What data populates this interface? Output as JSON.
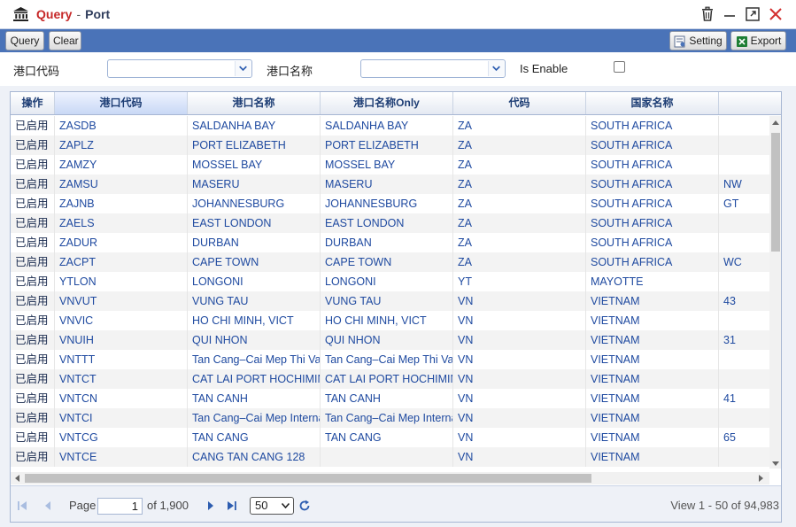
{
  "window": {
    "title": "Query",
    "separator": "-",
    "subtitle": "Port",
    "icons": [
      "bank-icon",
      "trash-icon",
      "minimize-icon",
      "maximize-icon",
      "close-icon"
    ]
  },
  "toolbar": {
    "query_label": "Query",
    "clear_label": "Clear",
    "setting_label": "Setting",
    "export_label": "Export"
  },
  "filters": {
    "port_code_label": "港口代码",
    "port_name_label": "港口名称",
    "is_enable_label": "Is Enable",
    "port_code_value": "",
    "port_name_value": ""
  },
  "grid": {
    "columns": [
      "操作",
      "港口代码",
      "港口名称",
      "港口名称Only",
      "代码",
      "国家名称",
      ""
    ],
    "rows": [
      [
        "已启用",
        "ZASDB",
        "SALDANHA BAY",
        "SALDANHA BAY",
        "ZA",
        "SOUTH AFRICA",
        ""
      ],
      [
        "已启用",
        "ZAPLZ",
        "PORT ELIZABETH",
        "PORT ELIZABETH",
        "ZA",
        "SOUTH AFRICA",
        ""
      ],
      [
        "已启用",
        "ZAMZY",
        "MOSSEL BAY",
        "MOSSEL BAY",
        "ZA",
        "SOUTH AFRICA",
        ""
      ],
      [
        "已启用",
        "ZAMSU",
        "MASERU",
        "MASERU",
        "ZA",
        "SOUTH AFRICA",
        "NW"
      ],
      [
        "已启用",
        "ZAJNB",
        "JOHANNESBURG",
        "JOHANNESBURG",
        "ZA",
        "SOUTH AFRICA",
        "GT"
      ],
      [
        "已启用",
        "ZAELS",
        "EAST LONDON",
        "EAST LONDON",
        "ZA",
        "SOUTH AFRICA",
        ""
      ],
      [
        "已启用",
        "ZADUR",
        "DURBAN",
        "DURBAN",
        "ZA",
        "SOUTH AFRICA",
        ""
      ],
      [
        "已启用",
        "ZACPT",
        "CAPE TOWN",
        "CAPE TOWN",
        "ZA",
        "SOUTH AFRICA",
        "WC"
      ],
      [
        "已启用",
        "YTLON",
        "LONGONI",
        "LONGONI",
        "YT",
        "MAYOTTE",
        ""
      ],
      [
        "已启用",
        "VNVUT",
        "VUNG TAU",
        "VUNG TAU",
        "VN",
        "VIETNAM",
        "43"
      ],
      [
        "已启用",
        "VNVIC",
        "HO CHI MINH, VICT",
        "HO CHI MINH, VICT",
        "VN",
        "VIETNAM",
        ""
      ],
      [
        "已启用",
        "VNUIH",
        "QUI NHON",
        "QUI NHON",
        "VN",
        "VIETNAM",
        "31"
      ],
      [
        "已启用",
        "VNTTT",
        "Tan Cang–Cai Mep Thi Vai",
        "Tan Cang–Cai Mep Thi Vai",
        "VN",
        "VIETNAM",
        ""
      ],
      [
        "已启用",
        "VNTCT",
        "CAT LAI PORT HOCHIMINH",
        "CAT LAI PORT HOCHIMINH",
        "VN",
        "VIETNAM",
        ""
      ],
      [
        "已启用",
        "VNTCN",
        "TAN CANH",
        "TAN CANH",
        "VN",
        "VIETNAM",
        "41"
      ],
      [
        "已启用",
        "VNTCI",
        "Tan Cang–Cai Mep International",
        "Tan Cang–Cai Mep International",
        "VN",
        "VIETNAM",
        ""
      ],
      [
        "已启用",
        "VNTCG",
        "TAN CANG",
        "TAN CANG",
        "VN",
        "VIETNAM",
        "65"
      ],
      [
        "已启用",
        "VNTCE",
        "CANG TAN CANG 128",
        "",
        "VN",
        "VIETNAM",
        ""
      ]
    ]
  },
  "pager": {
    "page_label": "Page",
    "current_page": "1",
    "of_total": "of 1,900",
    "page_size": "50",
    "view_summary": "View 1 - 50 of 94,983"
  },
  "colors": {
    "toolbar_bg": "#4a73b8",
    "title_accent": "#c62828",
    "link_text": "#1f4aa0"
  }
}
